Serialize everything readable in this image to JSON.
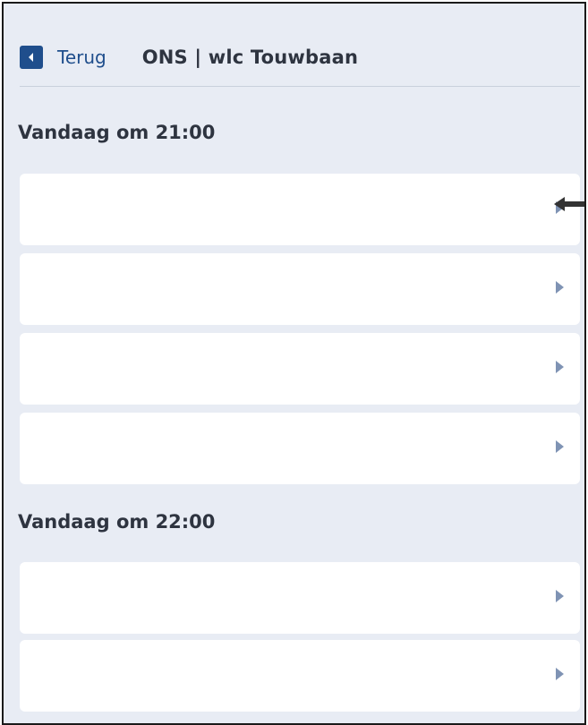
{
  "header": {
    "back_label": "Terug",
    "title": "ONS | wlc Touwbaan"
  },
  "sections": [
    {
      "heading": "Vandaag om 21:00",
      "row_count": 4
    },
    {
      "heading": "Vandaag om 22:00",
      "row_count": 2
    }
  ],
  "colors": {
    "page_background": "#e8ecf4",
    "accent": "#1f4e8c",
    "row_background": "#ffffff",
    "chevron": "#7f93b4",
    "annotation_arrow": "#333333"
  },
  "icons": {
    "back": "chevron-left-icon",
    "row": "chevron-right-icon",
    "annotation": "arrow-left-icon"
  }
}
